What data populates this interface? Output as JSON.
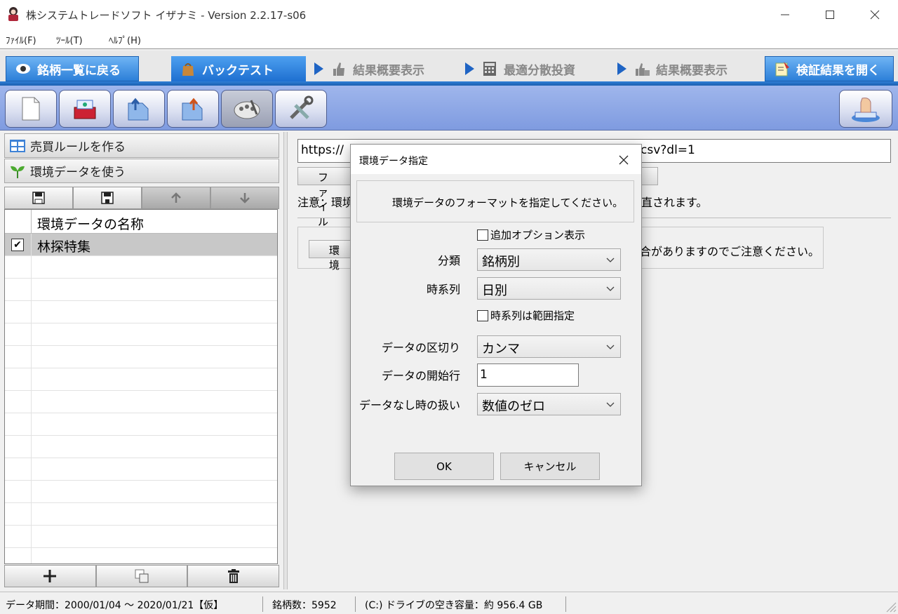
{
  "window": {
    "title": "株システムトレードソフト イザナミ - Version 2.2.17-s06"
  },
  "menubar": {
    "items": [
      "ﾌｧｲﾙ(F)",
      "ﾂｰﾙ(T)",
      "ﾍﾙﾌﾟ(H)"
    ]
  },
  "tabs": {
    "back": "銘柄一覧に戻る",
    "backtest": "バックテスト",
    "summary1": "結果概要表示",
    "optimize": "最適分散投資",
    "summary2": "結果概要表示",
    "open_result": "検証結果を開く"
  },
  "toolbar": {
    "icons": [
      "new-document-icon",
      "import-icon",
      "export-icon",
      "export-alt-icon",
      "palette-icon",
      "tools-icon",
      "stamp-icon"
    ]
  },
  "left_panel": {
    "rule_header": "売買ルールを作る",
    "env_header": "環境データを使う",
    "column_header": "環境データの名称",
    "rows": [
      {
        "checked": true,
        "name": "林探特集"
      }
    ]
  },
  "right_panel": {
    "url_start": "https://",
    "url_end": "csv?dl=1",
    "file_button": "ファイル",
    "note_prefix": "注意：環境",
    "note_suffix": "直されます。",
    "env_button": "環境",
    "box_text": "合がありますのでご注意ください。"
  },
  "dialog": {
    "title": "環境データ指定",
    "message": "環境データのフォーマットを指定してください。",
    "option_checkbox": "追加オプション表示",
    "category_label": "分類",
    "category_value": "銘柄別",
    "timeseries_label": "時系列",
    "timeseries_value": "日別",
    "range_checkbox": "時系列は範囲指定",
    "delimiter_label": "データの区切り",
    "delimiter_value": "カンマ",
    "start_row_label": "データの開始行",
    "start_row_value": "1",
    "missing_label": "データなし時の扱い",
    "missing_value": "数値のゼロ",
    "ok": "OK",
    "cancel": "キャンセル"
  },
  "status": {
    "period": "データ期間：2000/01/04 〜 2020/01/21【仮】",
    "count": "銘柄数：5952",
    "drive": "(C:) ドライブの空き容量：約 956.4 GB"
  },
  "colors": {
    "accent_blue": "#2c7fd8",
    "toolbar_blue": "#8ea8e6"
  }
}
